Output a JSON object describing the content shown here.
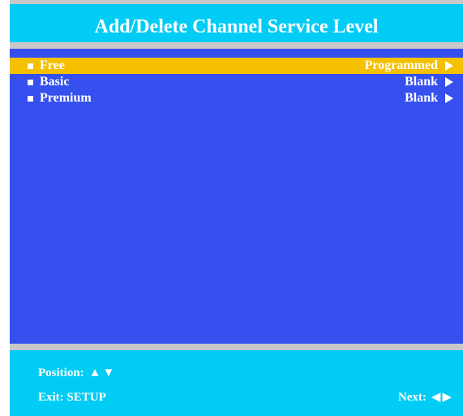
{
  "title": "Add/Delete Channel Service Level",
  "menu": {
    "items": [
      {
        "label": "Free",
        "value": "Programmed",
        "arrow": "▶",
        "selected": true
      },
      {
        "label": "Basic",
        "value": "Blank",
        "arrow": "▶",
        "selected": false
      },
      {
        "label": "Premium",
        "value": "Blank",
        "arrow": "▶",
        "selected": false
      }
    ]
  },
  "footer": {
    "position_label": "Position:",
    "position_glyph": "▲▼",
    "exit_label": "Exit: SETUP",
    "next_label": "Next:",
    "next_glyph": "◀▶"
  },
  "colors": {
    "header_bg": "#00ccf5",
    "menu_bg": "#3550ee",
    "selected_bg": "#f5c000",
    "rule": "#c8c8c8",
    "text": "#ffffff"
  },
  "icons": {
    "bullet": "square-bullet-icon",
    "arrow": "right-arrow-icon",
    "position": "up-down-arrows-icon",
    "next": "left-right-arrows-icon"
  }
}
